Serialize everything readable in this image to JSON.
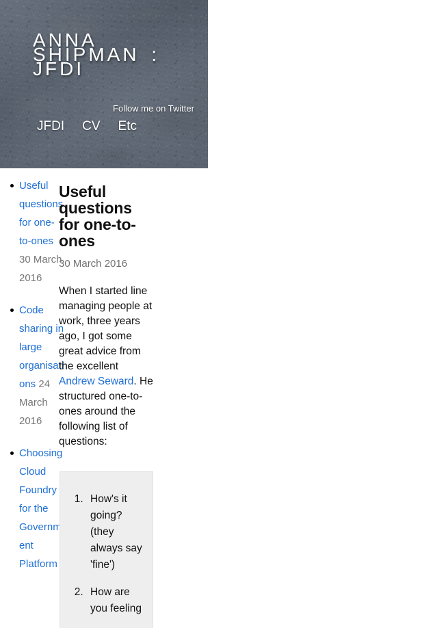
{
  "site": {
    "title": "ANNA SHIPMAN : JFDI",
    "banner_bg_color": "#5a6471"
  },
  "nav": {
    "twitter_label": "Follow me on Twitter",
    "items": [
      {
        "label": "JFDI"
      },
      {
        "label": "CV"
      },
      {
        "label": "Etc"
      }
    ]
  },
  "sidebar": {
    "posts": [
      {
        "title": "Useful questions for one-to-ones",
        "date": "30 March 2016"
      },
      {
        "title": "Code sharing in large organisations",
        "date": "24 March 2016"
      },
      {
        "title": "Choosing Cloud Foundry for the Government Platform",
        "date": ""
      }
    ]
  },
  "article": {
    "title": "Useful questions for one-to-ones",
    "date": "30 March 2016",
    "body_part1": "When I started line managing people at work, three years ago, I got some great advice from the excellent ",
    "body_link": "Andrew Seward",
    "body_part2": ". He structured one-to-ones around the following list of questions:",
    "questions": [
      "How's it going? (they always say 'fine')",
      "How are you feeling"
    ]
  },
  "colors": {
    "link": "#1d6fd4",
    "muted_text": "#777777",
    "box_bg": "#eeeeee"
  }
}
